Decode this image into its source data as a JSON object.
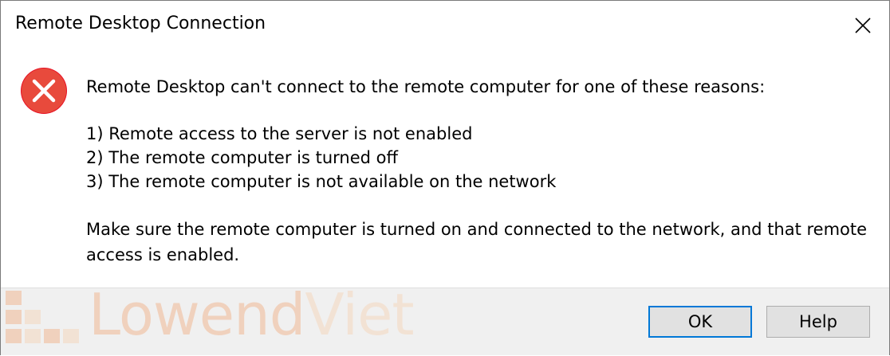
{
  "window": {
    "title": "Remote Desktop Connection"
  },
  "message": {
    "headline": "Remote Desktop can't connect to the remote computer for one of these reasons:",
    "reasons": [
      "1) Remote access to the server is not enabled",
      "2) The remote computer is turned off",
      "3) The remote computer is not available on the network"
    ],
    "advice_line1": "Make sure the remote computer is turned on and connected to the network, and that remote",
    "advice_line2": "access is enabled."
  },
  "buttons": {
    "ok_label": "OK",
    "help_label": "Help"
  },
  "watermark": {
    "text_part1": "Lowend",
    "text_part2": "Viet"
  },
  "icons": {
    "error": "error-icon",
    "close": "close-icon"
  },
  "colors": {
    "error_red": "#e81123",
    "default_button_border": "#0078d7",
    "footer_bg": "#f0f0f0",
    "watermark_orange": "#f0a878"
  }
}
